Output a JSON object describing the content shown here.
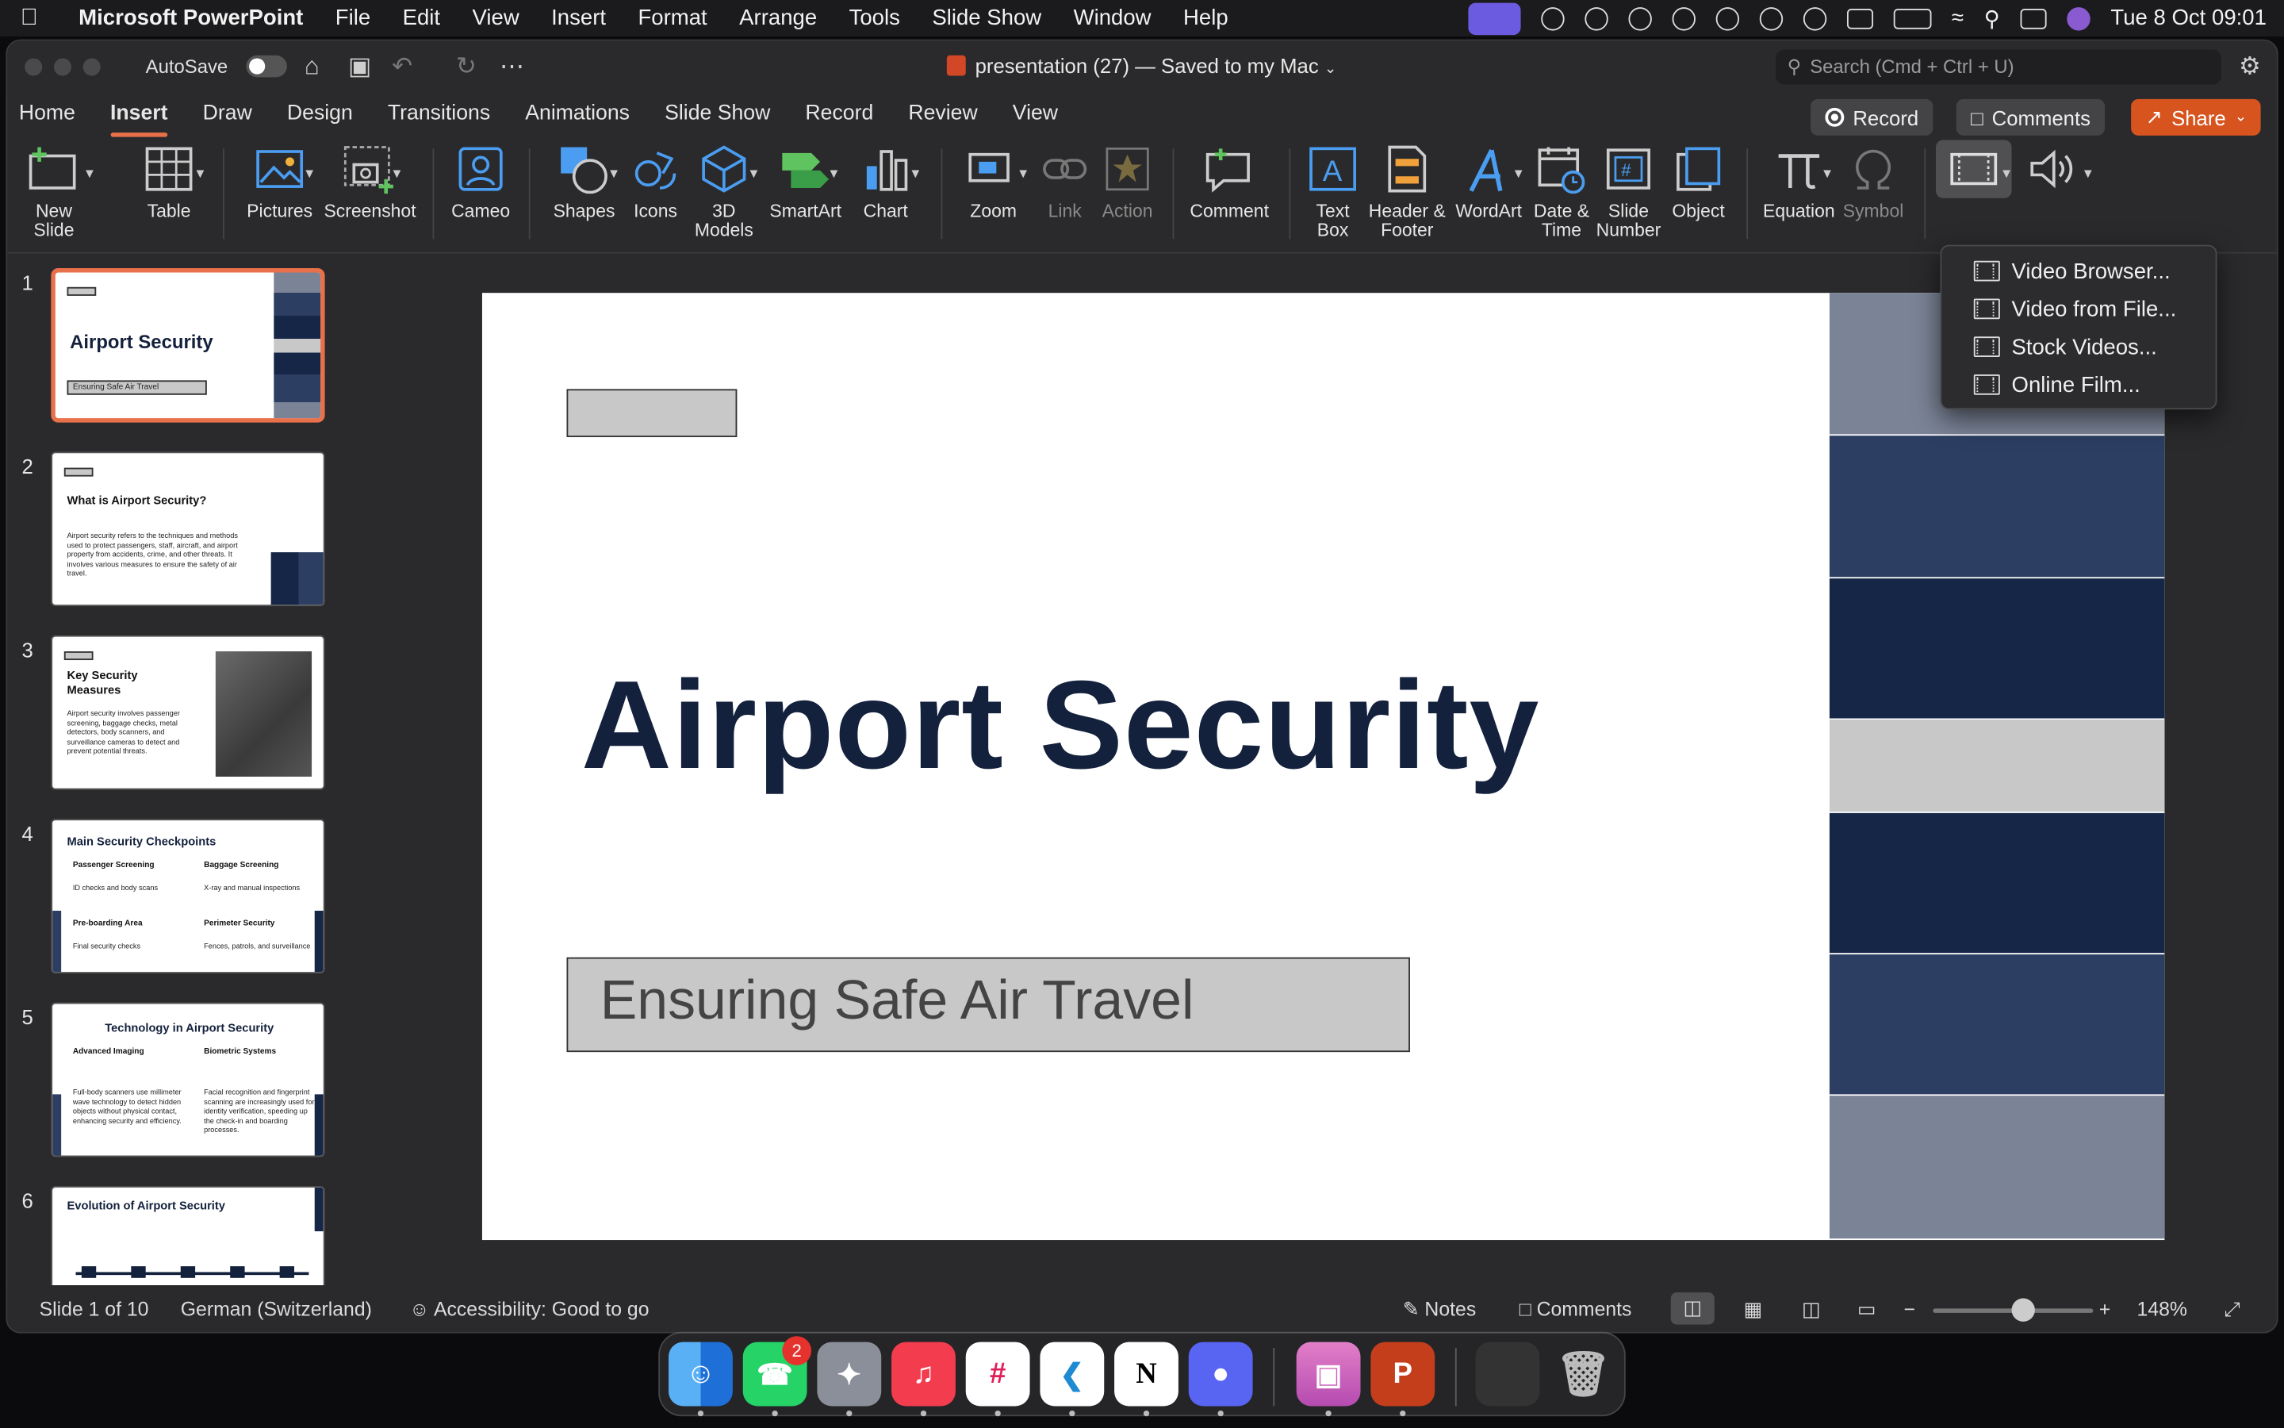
{
  "menubar": {
    "app": "Microsoft PowerPoint",
    "items": [
      "File",
      "Edit",
      "View",
      "Insert",
      "Format",
      "Arrange",
      "Tools",
      "Slide Show",
      "Window",
      "Help"
    ],
    "datetime": "Tue 8 Oct  09:01"
  },
  "titlebar": {
    "autosave": "AutoSave",
    "doc_title": "presentation (27) — Saved to my Mac",
    "search_placeholder": "Search (Cmd + Ctrl + U)"
  },
  "tabs": [
    "Home",
    "Insert",
    "Draw",
    "Design",
    "Transitions",
    "Animations",
    "Slide Show",
    "Record",
    "Review",
    "View"
  ],
  "active_tab": "Insert",
  "actions": {
    "record": "Record",
    "comments": "Comments",
    "share": "Share"
  },
  "ribbon": {
    "new_slide": "New Slide",
    "table": "Table",
    "pictures": "Pictures",
    "screenshot": "Screenshot",
    "cameo": "Cameo",
    "shapes": "Shapes",
    "icons": "Icons",
    "models": "3D Models",
    "smartart": "SmartArt",
    "chart": "Chart",
    "zoom": "Zoom",
    "link": "Link",
    "action": "Action",
    "comment": "Comment",
    "text_box": "Text Box",
    "header_footer": "Header & Footer",
    "wordart": "WordArt",
    "date_time": "Date & Time",
    "slide_number": "Slide Number",
    "object": "Object",
    "equation": "Equation",
    "symbol": "Symbol"
  },
  "video_menu": [
    "Video Browser...",
    "Video from File...",
    "Stock Videos...",
    "Online Film..."
  ],
  "thumbnails": [
    {
      "num": "1",
      "title": "Airport Security",
      "subtitle": "Ensuring Safe Air Travel"
    },
    {
      "num": "2",
      "title": "What is Airport Security?",
      "body": "Airport security refers to the techniques and methods used to protect passengers, staff, aircraft, and airport property from accidents, crime, and other threats. It involves various measures to ensure the safety of air travel."
    },
    {
      "num": "3",
      "title": "Key Security Measures",
      "body": "Airport security involves passenger screening, baggage checks, metal detectors, body scanners, and surveillance cameras to detect and prevent potential threats."
    },
    {
      "num": "4",
      "title": "Main Security Checkpoints",
      "c1h": "Passenger Screening",
      "c1b": "ID checks and body scans",
      "c2h": "Baggage Screening",
      "c2b": "X-ray and manual inspections",
      "c3h": "Pre-boarding Area",
      "c3b": "Final security checks",
      "c4h": "Perimeter Security",
      "c4b": "Fences, patrols, and surveillance"
    },
    {
      "num": "5",
      "title": "Technology in Airport Security",
      "c1h": "Advanced Imaging",
      "c1b": "Full-body scanners use millimeter wave technology to detect hidden objects without physical contact, enhancing security and efficiency.",
      "c2h": "Biometric Systems",
      "c2b": "Facial recognition and fingerprint scanning are increasingly used for identity verification, speeding up the check-in and boarding processes."
    },
    {
      "num": "6",
      "title": "Evolution of Airport Security"
    }
  ],
  "slide": {
    "title": "Airport Security",
    "subtitle": "Ensuring Safe Air Travel",
    "stripe_colors": [
      "#7b8497",
      "#2c3e62",
      "#162647",
      "#c8c8c8",
      "#162647",
      "#2c3e62",
      "#7b8497"
    ]
  },
  "status": {
    "slide_pos": "Slide 1 of 10",
    "language": "German (Switzerland)",
    "accessibility": "Accessibility: Good to go",
    "notes": "Notes",
    "comments": "Comments",
    "zoom": "148%"
  },
  "dock": {
    "whatsapp_badge": "2"
  }
}
